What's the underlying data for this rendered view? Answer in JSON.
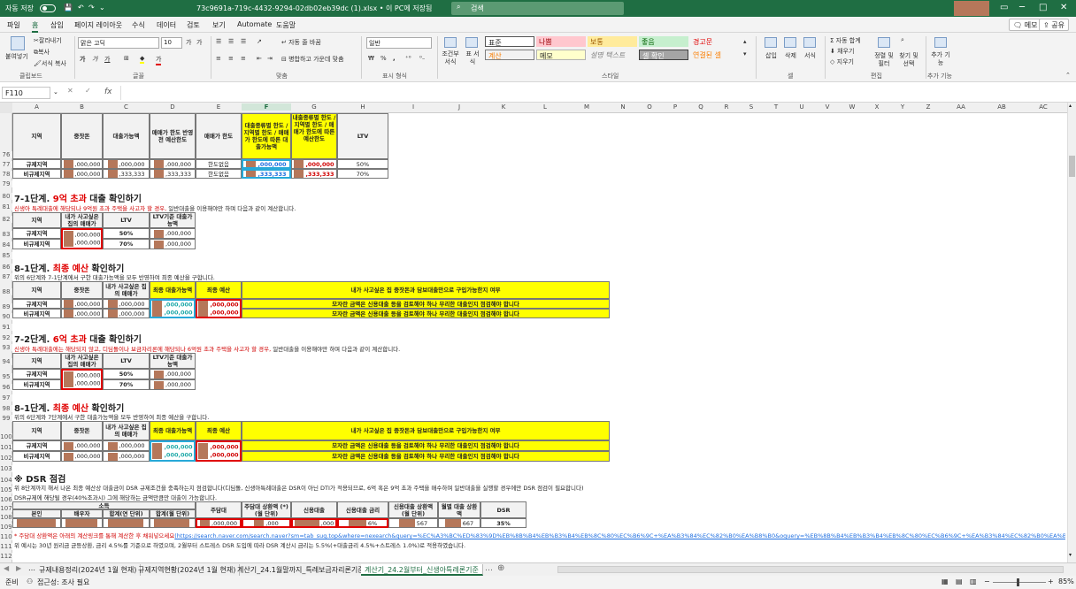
{
  "titlebar": {
    "autosave": "자동 저장",
    "filename": "73c9691a-719c-4432-9294-02db02eb39dc (1).xlsx • 이 PC에 저장됨",
    "search": "검색",
    "minimize": "─",
    "restore": "□",
    "close": "✕"
  },
  "menu": {
    "items": [
      "파일",
      "홈",
      "삽입",
      "페이지 레이아웃",
      "수식",
      "데이터",
      "검토",
      "보기",
      "Automate",
      "도움말"
    ],
    "memo": "메모",
    "share": "공유"
  },
  "ribbon": {
    "paste": "붙여넣기",
    "cut": "잘라내기",
    "copy": "복사",
    "format_painter": "서식 복사",
    "clipboard": "클립보드",
    "font_name": "맑은 고딕",
    "font_size": "10",
    "grow": "가",
    "shrink": "가",
    "bold": "가",
    "italic": "가",
    "underline": "가",
    "font_color": "가",
    "font": "글꼴",
    "wrap": "자동 줄 바꿈",
    "merge": "병합하고 가운데 맞춤",
    "align": "맞춤",
    "number_format": "일반",
    "percent": "%",
    "comma": ",",
    "number": "표시 형식",
    "cond_format": "조건부 서식",
    "table_format": "표 서식",
    "styles": [
      "표준",
      "나쁨",
      "보통",
      "좋음",
      "경고문",
      "계산",
      "메모",
      "설명 텍스트",
      "셀 확인",
      "연결된 셀"
    ],
    "styles_label": "스타일",
    "insert": "삽입",
    "delete": "삭제",
    "format": "서식",
    "cells": "셀",
    "autosum": "자동 합계",
    "fill": "채우기",
    "clear": "지우기",
    "sort": "정렬 및 필터",
    "find": "찾기 및 선택",
    "editing": "편집",
    "addins": "추가 기능",
    "addins_group": "추가 기능"
  },
  "formula_bar": {
    "name_box": "F110",
    "cancel": "✕",
    "enter": "✓",
    "fx": "fx",
    "value": ""
  },
  "columns": [
    "A",
    "B",
    "C",
    "D",
    "E",
    "F",
    "G",
    "H",
    "I",
    "J",
    "K",
    "L",
    "M",
    "N",
    "O",
    "P",
    "Q",
    "R",
    "S",
    "T",
    "U",
    "V",
    "W",
    "X",
    "Y",
    "Z",
    "AA",
    "AB",
    "AC"
  ],
  "selected_column": "F",
  "rows": [
    "76",
    "77",
    "78",
    "79",
    "80",
    "81",
    "82",
    "83",
    "84",
    "85",
    "86",
    "87",
    "88",
    "89",
    "90",
    "91",
    "92",
    "93",
    "94",
    "95",
    "96",
    "97",
    "98",
    "99",
    "100",
    "101",
    "102",
    "103",
    "104",
    "105",
    "106",
    "107",
    "108",
    "109",
    "110",
    "111",
    "112"
  ],
  "t1": {
    "headers": [
      "지역",
      "중잣돈",
      "대출가능액",
      "매매가 한도 반영 전 예산한도",
      "매매가 한도",
      "대출종류별 한도 / 지역별 한도 / 매매가 한도에 따른 대출가능액",
      "내출종류별 한도 / 지역별 한도 / 매매가 한도에 따른 예산한도",
      "LTV"
    ],
    "rows": [
      [
        "규제지역",
        ",000,000",
        ",000,000",
        ",000,000",
        "한도없음",
        ",000,000",
        ",000,000",
        "50%"
      ],
      [
        "비규제지역",
        ",000,000",
        ",333,333",
        ",333,333",
        "한도없음",
        ",333,333",
        ",333,333",
        "70%"
      ]
    ]
  },
  "s71": {
    "title_a": "7-1단계.",
    "title_b": "9억 초과",
    "title_c": "대출 확인하기",
    "desc_a": "신생아 특례대출에 해당되나 9억원 초과 주택을 사고자 할 경우,",
    "desc_b": " 일반대출을 이용해야만 하며 다음과 같이 계산합니다."
  },
  "t2": {
    "headers": [
      "지역",
      "내가 사고싶은 집의 매매가",
      "LTV",
      "LTV기준 대출가능액"
    ],
    "rows": [
      [
        "규제지역",
        ",000,000",
        "50%",
        ",000,000"
      ],
      [
        "비규제지역",
        ",000,000",
        "70%",
        ",000,000"
      ]
    ]
  },
  "s81": {
    "title_a": "8-1단계.",
    "title_b": "최종 예산",
    "title_c": "확인하기",
    "desc": "위의 6단계와 7-1단계에서 구한 대출가능액을 모두 반영하여 최종 예산을 구합니다."
  },
  "t3": {
    "headers": [
      "지역",
      "중잣돈",
      "내가 사고싶은 집의 매매가",
      "최종 대출가능액",
      "최종 예산",
      "내가 사고싶은 집 중잣돈과 담보대출만으로 구입가능한지 여부"
    ],
    "rows": [
      [
        "규제지역",
        ",000,000",
        ",000,000",
        ",000,000",
        ",000,000",
        "모자란 금액은 신용대출 등을 검토해야 하나 무리한 대출인지 점검해야 합니다"
      ],
      [
        "비규제지역",
        ",000,000",
        ",000,000",
        ",000,000",
        ",000,000",
        "모자란 금액은 신용대출 등을 검토해야 하나 무리한 대출인지 점검해야 합니다"
      ]
    ]
  },
  "s72": {
    "title_a": "7-2단계.",
    "title_b": "6억 초과",
    "title_c": "대출 확인하기",
    "desc_a": "신생아 특례대출에는 해당되지 않고, 디딤돌이나 보금자리론에 해당되나 6억원 초과 주택을 사고자 할 경우,",
    "desc_b": " 일반대출을 이용해야만 하며 다음과 같이 계산합니다."
  },
  "t4": {
    "headers": [
      "지역",
      "내가 사고싶은 집의 매매가",
      "LTV",
      "LTV기준 대출가능액"
    ],
    "rows": [
      [
        "규제지역",
        ",000,000",
        "50%",
        ",000,000"
      ],
      [
        "비규제지역",
        ",000,000",
        "70%",
        ",000,000"
      ]
    ]
  },
  "s82": {
    "title_a": "8-1단계.",
    "title_b": "최종 예산",
    "title_c": "확인하기",
    "desc": "위의 6단계와 7단계에서 구한 대출가능액을 모두 반영하여 최종 예산을 구합니다."
  },
  "t5": {
    "headers": [
      "지역",
      "중잣돈",
      "내가 사고싶은 집의 매매가",
      "최종 대출가능액",
      "최종 예산",
      "내가 사고싶은 집 중잣돈과 담보대출만으로 구입가능한지 여부"
    ],
    "rows": [
      [
        "규제지역",
        ",000,000",
        ",000,000",
        ",000,000",
        ",000,000",
        "모자란 금액은 신용대출 등을 검토해야 하나 무리한 대출인지 점검해야 합니다"
      ],
      [
        "비규제지역",
        ",000,000",
        ",000,000",
        ",000,000",
        ",000,000",
        "모자란 금액은 신용대출 등을 검토해야 하나 무리한 대출인지 점검해야 합니다"
      ]
    ]
  },
  "dsr": {
    "title": "※ DSR 점검",
    "desc1": "위 8단계까지 해서 나온 최종 예산상 대출금이 DSR 규제조건을 충족하는지 점검합니다(디딤돌, 신생아특례대출은 DSR이 아닌 DTI가 적용되므로, 6억 혹은 9억 초과 주택을 매수하며 일반대출을 실행할 경우에만 DSR 점검이 필요합니다)",
    "desc2": "DSR규제에 해당될 경우(40%조과시) 그에 해당하는 금액만큼만 대출이 가능합니다.",
    "income_group": "소득",
    "headers": [
      "본인",
      "배우자",
      "합계(연 단위)",
      "합계(월 단위)",
      "주담대",
      "주담대 상환액 (*) (월 단위)",
      "신용대출",
      "신용대출 금리",
      "신용대출 상환액 (월 단위)",
      "월별 대출 상환액",
      "DSR"
    ],
    "values": [
      "",
      "",
      "",
      "",
      ",000,000",
      ",000",
      ",000",
      "6%",
      "567",
      "667",
      "35%"
    ],
    "note_a": "* 주담대 상환액은 아래의 계산링크를 통해 계산한 후 채워넣으세요",
    "note_link": "(https://search.naver.com/search.naver?sm=tab_sug.top&where=nexearch&query=%EC%A3%BC%ED%83%9D%EB%8B%B4%EB%B3%B4%EB%8C%80%EC%B6%9C+%EA%B3%84%EC%82%B0%EA%B8%B0&oquery=%EB%8B%B4%EB%B3%B4%EB%8C%80%EC%B6%9C+%EA%B3%84%EC%82%B0%EA%B8%B0&tqi=iU%2F1yP\\pnvOsssB%2Fb5vKssssst",
    "desc3": "위 예시는 30년 원리금 균등상환, 금리 4.5%를 기준으로 하였으며, 2월부터 스트레스 DSR 도입에 따라 DSR 계산시 금리는 5.5%(+대출금리 4.5%+스트레스 1.0%)로 적용하였습니다."
  },
  "tabs": [
    "규제내용정리(2024년 1월 현재)",
    "규제지역현황(2024년 1월 현재)",
    "계산기_24.1월말까지_특례보금자리론기준",
    "계산기_24.2월부터_신생아특례론기준"
  ],
  "active_tab": 3,
  "status": {
    "ready": "준비",
    "accessibility": "접근성: 조사 필요",
    "zoom": "85%"
  },
  "colors": {
    "excel_green": "#1f6e43",
    "highlight": "#ffff00",
    "accent_red": "#e00000",
    "value_blue": "#1f6fe0",
    "redacted": "#b5775a"
  }
}
